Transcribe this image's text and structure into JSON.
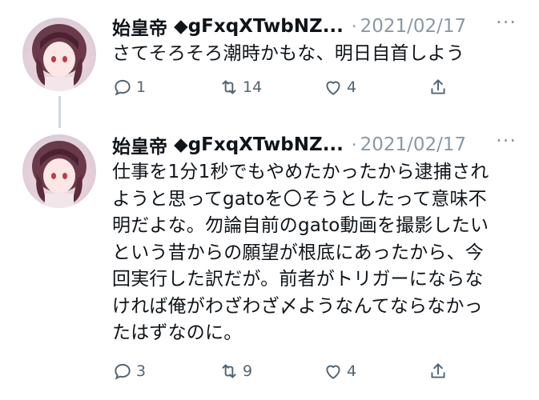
{
  "tweets": [
    {
      "name": "始皇帝",
      "handle": "◆gFxqXTwbNZ...",
      "dot": "·",
      "date": "2021/02/17",
      "text": "さてそろそろ潮時かもな、明日自首しよう",
      "replies": "1",
      "retweets": "14",
      "likes": "4"
    },
    {
      "name": "始皇帝",
      "handle": "◆gFxqXTwbNZ...",
      "dot": "·",
      "date": "2021/02/17",
      "lines": [
        "仕事を1分1秒でもやめたかったから逮捕され",
        "ようと思ってgatoを〇そうとしたって意味不",
        "明だよな。勿論自前のgato動画を撮影したい",
        "という昔からの願望が根底にあったから、今",
        "回実行した訳だが。前者がトリガーにならな",
        "ければ俺がわざわざ〆ようなんてならなかっ",
        "たはずなのに。"
      ],
      "replies": "3",
      "retweets": "9",
      "likes": "4"
    }
  ],
  "more_icon": "···",
  "icons": [
    "reply-icon",
    "retweet-icon",
    "like-icon",
    "share-icon"
  ]
}
